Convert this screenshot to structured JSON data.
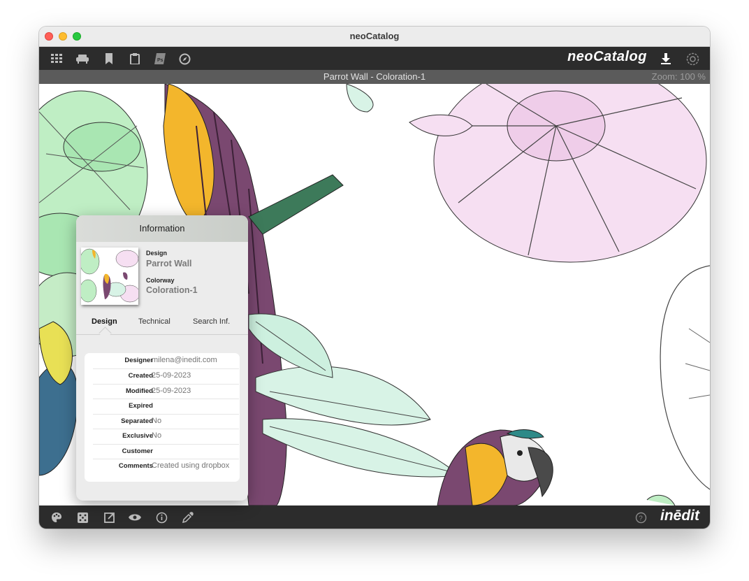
{
  "window": {
    "title": "neoCatalog"
  },
  "toolbar": {
    "icons": [
      "grid-icon",
      "sofa-icon",
      "bookmark-icon",
      "clipboard-icon",
      "photoshop-icon",
      "compass-icon"
    ],
    "brand": "neoCatalog",
    "right_icons": [
      "download-icon",
      "settings-icon"
    ]
  },
  "document": {
    "title": "Parrot Wall - Coloration-1",
    "zoom": "Zoom: 100 %"
  },
  "info_panel": {
    "title": "Information",
    "design_label": "Design",
    "design_value": "Parrot Wall",
    "colorway_label": "Colorway",
    "colorway_value": "Coloration-1",
    "tabs": [
      "Design",
      "Technical",
      "Search Inf."
    ],
    "active_tab": "Design",
    "fields": [
      {
        "key": "Designer",
        "value": "milena@inedit.com"
      },
      {
        "key": "Created",
        "value": "25-09-2023"
      },
      {
        "key": "Modified",
        "value": "25-09-2023"
      },
      {
        "key": "Expired",
        "value": ""
      },
      {
        "key": "Separated",
        "value": "No"
      },
      {
        "key": "Exclusive",
        "value": "No"
      },
      {
        "key": "Customer",
        "value": ""
      },
      {
        "key": "Comments",
        "value": "Created using dropbox"
      }
    ]
  },
  "bottombar": {
    "icons": [
      "palette-icon",
      "dice-icon",
      "external-link-icon",
      "eye-icon",
      "info-icon",
      "eyedropper-icon"
    ],
    "help_icon": "help-icon",
    "logo": "inēdit"
  },
  "colors": {
    "toolbar_bg": "#2c2c2c",
    "docbar_bg": "#5b5b5b",
    "panel_bg": "#ececec",
    "pink_flower": "#f6dff2",
    "green_leaf": "#bfeec4",
    "mint_leaf": "#d8f3e6",
    "parrot_purple": "#7a4870",
    "parrot_yellow": "#f3b62c"
  }
}
